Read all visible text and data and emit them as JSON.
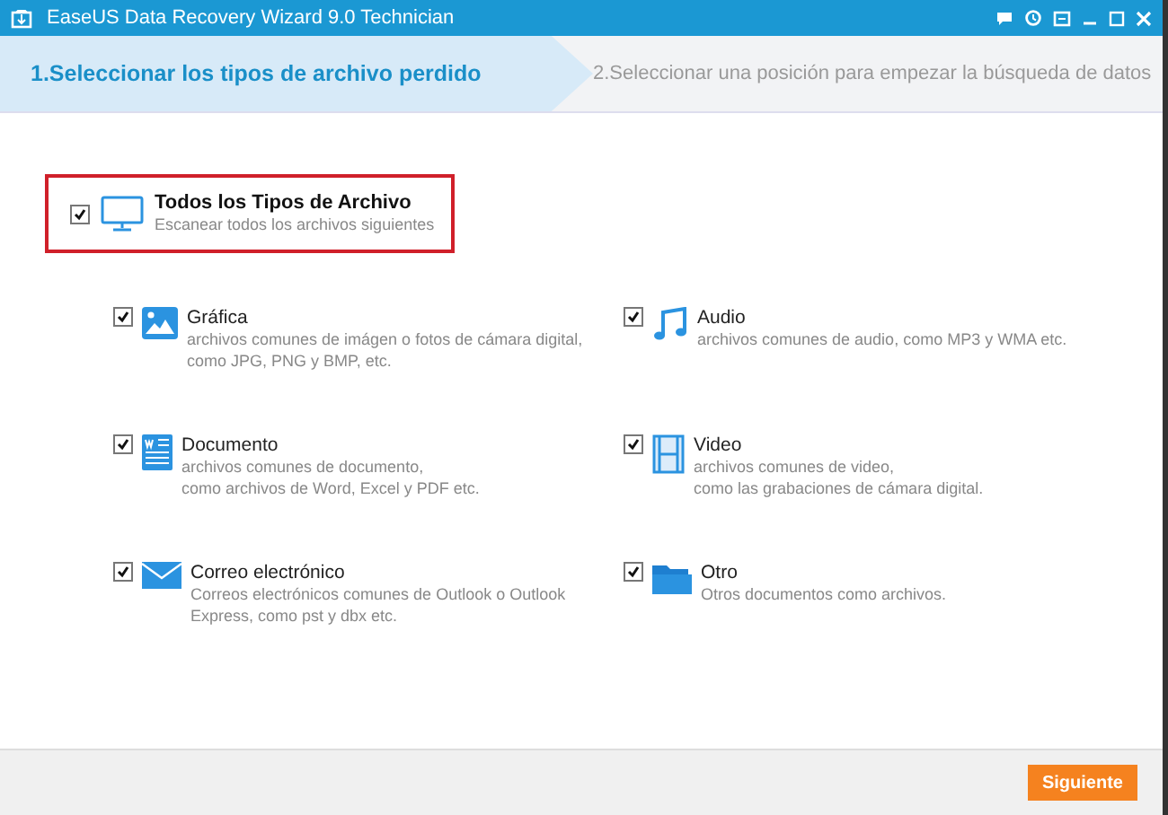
{
  "window": {
    "title": "EaseUS Data Recovery Wizard 9.0 Technician"
  },
  "steps": [
    {
      "label": "1.Seleccionar los tipos de archivo perdido",
      "selected": true
    },
    {
      "label": "2.Seleccionar una posición para empezar la búsqueda de datos",
      "selected": false
    }
  ],
  "all_types": {
    "title": "Todos los Tipos de Archivo",
    "description": "Escanear todos los archivos siguientes",
    "checked": true
  },
  "categories": [
    {
      "kind": "image",
      "title": "Gráfica",
      "description": [
        "archivos comunes de imágen o fotos de cámara digital,",
        "como JPG, PNG y BMP, etc."
      ],
      "checked": true
    },
    {
      "kind": "audio",
      "title": "Audio",
      "description": [
        "archivos comunes de audio, como MP3 y WMA etc."
      ],
      "checked": true
    },
    {
      "kind": "document",
      "title": "Documento",
      "description": [
        "archivos comunes de documento,",
        "como archivos de Word, Excel y PDF etc."
      ],
      "checked": true
    },
    {
      "kind": "video",
      "title": "Video",
      "description": [
        "archivos comunes de video,",
        "como las grabaciones de cámara digital."
      ],
      "checked": true
    },
    {
      "kind": "email",
      "title": "Correo electrónico",
      "description": [
        "Correos electrónicos comunes de Outlook o Outlook",
        "Express, como pst y dbx etc."
      ],
      "checked": true
    },
    {
      "kind": "other",
      "title": "Otro",
      "description": [
        "Otros documentos como archivos."
      ],
      "checked": true
    }
  ],
  "next_button": "Siguiente"
}
